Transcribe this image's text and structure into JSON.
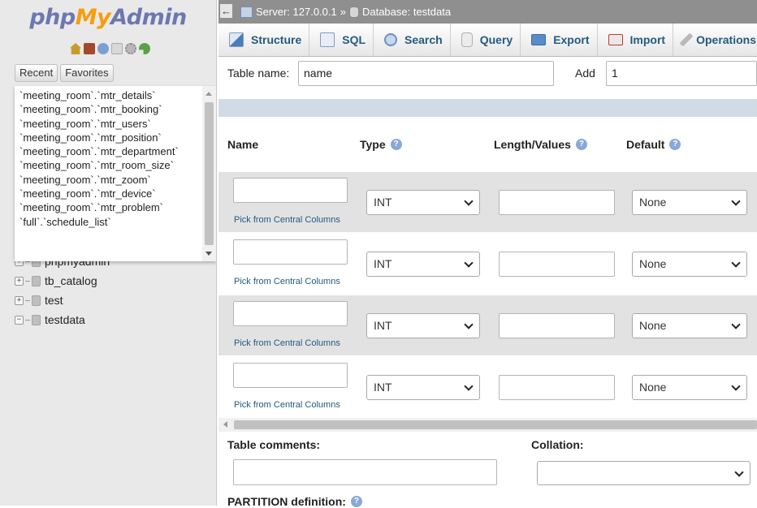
{
  "logo": {
    "part1": "php",
    "part2": "My",
    "part3": "Admin"
  },
  "nav_icons": [
    "home-icon",
    "exit-icon",
    "help-icon",
    "docs-icon",
    "settings-icon",
    "reload-icon"
  ],
  "recent_tabs": {
    "recent": "Recent",
    "favorites": "Favorites"
  },
  "recent_items": [
    "`meeting_room`.`mtr_details`",
    "`meeting_room`.`mtr_booking`",
    "`meeting_room`.`mtr_users`",
    "`meeting_room`.`mtr_position`",
    "`meeting_room`.`mtr_department`",
    "`meeting_room`.`mtr_room_size`",
    "`meeting_room`.`mtr_zoom`",
    "`meeting_room`.`mtr_device`",
    "`meeting_room`.`mtr_problem`",
    "`full`.`schedule_list`"
  ],
  "tree": [
    {
      "label": "phpmyadmin",
      "expander": "+"
    },
    {
      "label": "tb_catalog",
      "expander": "+"
    },
    {
      "label": "test",
      "expander": "+"
    },
    {
      "label": "testdata",
      "expander": "−"
    }
  ],
  "breadcrumb": {
    "collapse": "←",
    "server": "Server: 127.0.0.1",
    "sep": "»",
    "database": "Database: testdata"
  },
  "menu": [
    "Structure",
    "SQL",
    "Search",
    "Query",
    "Export",
    "Import",
    "Operations"
  ],
  "form": {
    "table_name_label": "Table name:",
    "table_name_value": "name",
    "add_label": "Add",
    "add_value": "1"
  },
  "columns": {
    "name": "Name",
    "type": "Type",
    "length": "Length/Values",
    "default": "Default"
  },
  "field_rows": [
    {
      "type": "INT",
      "default": "None",
      "pick": "Pick from Central Columns"
    },
    {
      "type": "INT",
      "default": "None",
      "pick": "Pick from Central Columns"
    },
    {
      "type": "INT",
      "default": "None",
      "pick": "Pick from Central Columns"
    },
    {
      "type": "INT",
      "default": "None",
      "pick": "Pick from Central Columns"
    }
  ],
  "table_comments_label": "Table comments:",
  "collation_label": "Collation:",
  "partition_label": "PARTITION definition:",
  "colors": {
    "link": "#235a81",
    "logo_blue": "#6c78af",
    "logo_orange": "#f89c0e",
    "topbar": "#8f8f8f"
  }
}
